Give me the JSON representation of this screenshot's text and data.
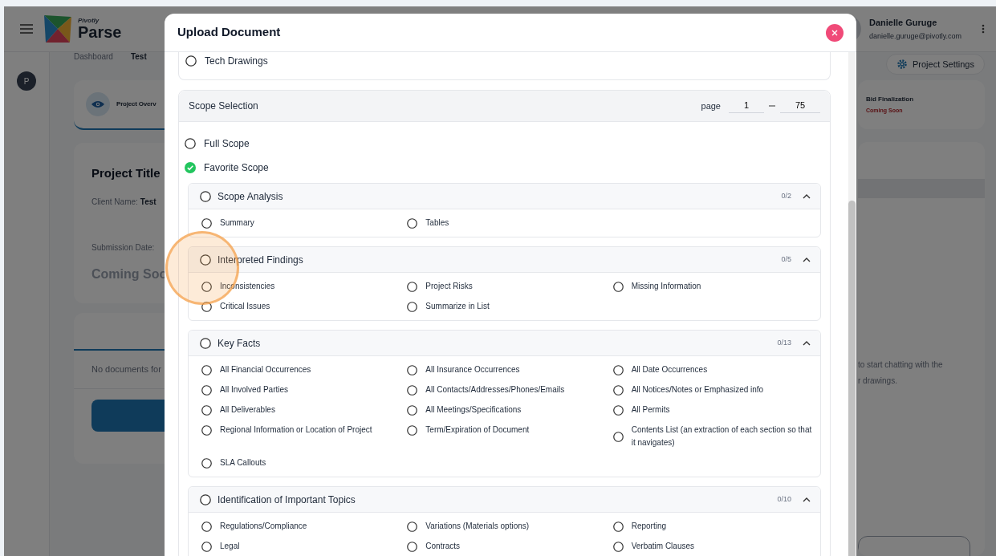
{
  "app": {
    "brand_small": "Pivotly",
    "brand": "Parse",
    "avatar": "P",
    "breadcrumb": [
      "Dashboard",
      "Test"
    ],
    "step": "Project Overv",
    "step_right": {
      "title": "Bid Finalization",
      "status": "Coming Soon"
    },
    "settings_button": "Project Settings",
    "user": {
      "name": "Danielle Guruge",
      "email": "danielle.guruge@pivotly.com"
    },
    "project": {
      "title": "Project Title",
      "client_label": "Client Name:",
      "client": "Test",
      "date_label": "Submission Date:",
      "date": "Coming Soo"
    },
    "documents_empty": "No documents for",
    "chat_hint": [
      "to start chatting with the",
      "r drawings."
    ]
  },
  "modal": {
    "title": "Upload Document",
    "document_types": [
      {
        "label": "Tech Drawings",
        "selected": false
      }
    ],
    "scope_selection": {
      "title": "Scope Selection",
      "page_label": "page",
      "page_from": "1",
      "page_to": "75",
      "options": [
        {
          "label": "Full Scope",
          "selected": false
        },
        {
          "label": "Favorite Scope",
          "selected": true
        }
      ],
      "groups": [
        {
          "title": "Scope Analysis",
          "count": "0/2",
          "checked": false,
          "expanded": true,
          "items": [
            {
              "label": "Summary",
              "checked": false
            },
            {
              "label": "Tables",
              "checked": false
            }
          ]
        },
        {
          "title": "Interpreted Findings",
          "count": "0/5",
          "checked": false,
          "expanded": true,
          "items": [
            {
              "label": "Inconsistencies",
              "checked": false
            },
            {
              "label": "Project Risks",
              "checked": false
            },
            {
              "label": "Missing Information",
              "checked": false
            },
            {
              "label": "Critical Issues",
              "checked": false
            },
            {
              "label": "Summarize in List",
              "checked": false
            }
          ]
        },
        {
          "title": "Key Facts",
          "count": "0/13",
          "checked": false,
          "expanded": true,
          "items": [
            {
              "label": "All Financial Occurrences",
              "checked": false
            },
            {
              "label": "All Insurance Occurrences",
              "checked": false
            },
            {
              "label": "All Date Occurrences",
              "checked": false
            },
            {
              "label": "All Involved Parties",
              "checked": false
            },
            {
              "label": "All Contacts/Addresses/Phones/Emails",
              "checked": false
            },
            {
              "label": "All Notices/Notes or Emphasized info",
              "checked": false
            },
            {
              "label": "All Deliverables",
              "checked": false
            },
            {
              "label": "All Meetings/Specifications",
              "checked": false
            },
            {
              "label": "All Permits",
              "checked": false
            },
            {
              "label": "Regional Information or Location of Project",
              "checked": false
            },
            {
              "label": "Term/Expiration of Document",
              "checked": false
            },
            {
              "label": "Contents List (an extraction of each section so that it navigates)",
              "checked": false
            },
            {
              "label": "SLA Callouts",
              "checked": false
            }
          ]
        },
        {
          "title": "Identification of Important Topics",
          "count": "0/10",
          "checked": false,
          "expanded": true,
          "items": [
            {
              "label": "Regulations/Compliance",
              "checked": false
            },
            {
              "label": "Variations (Materials options)",
              "checked": false
            },
            {
              "label": "Reporting",
              "checked": false
            },
            {
              "label": "Legal",
              "checked": false
            },
            {
              "label": "Contracts",
              "checked": false
            },
            {
              "label": "Verbatim Clauses",
              "checked": false
            }
          ]
        }
      ]
    }
  }
}
